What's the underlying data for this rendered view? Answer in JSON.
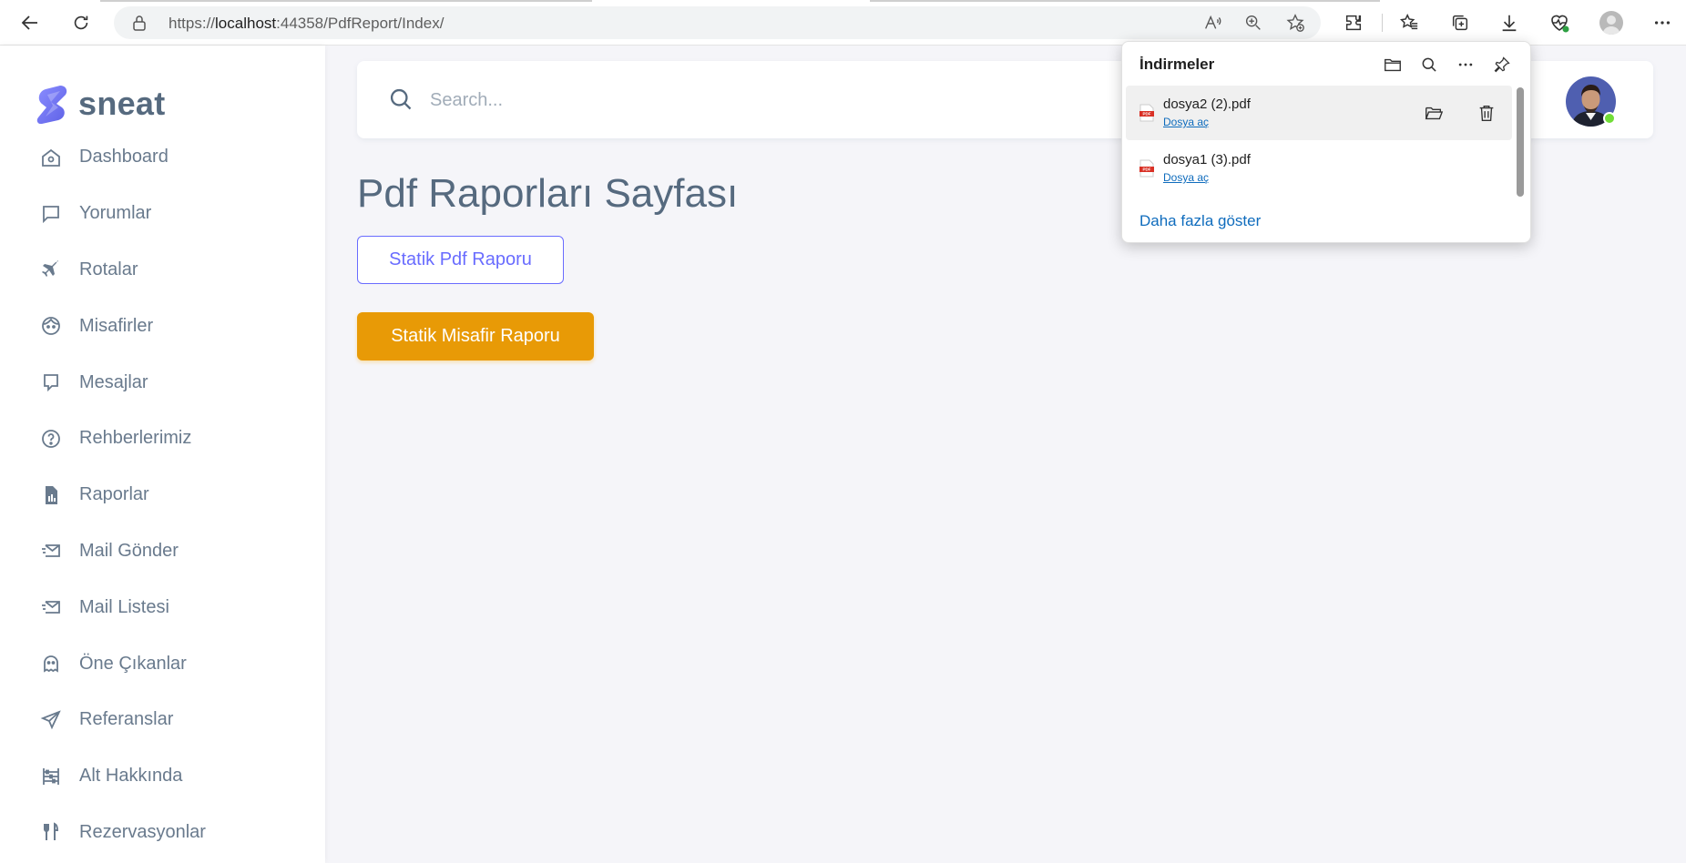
{
  "browser": {
    "url_prefix": "https://",
    "url_host": "localhost",
    "url_rest": ":44358/PdfReport/Index/"
  },
  "sidebar": {
    "brand": "sneat",
    "items": [
      {
        "label": "Dashboard",
        "icon": "home-icon"
      },
      {
        "label": "Yorumlar",
        "icon": "comment-icon"
      },
      {
        "label": "Rotalar",
        "icon": "plane-icon"
      },
      {
        "label": "Misafirler",
        "icon": "face-icon"
      },
      {
        "label": "Mesajlar",
        "icon": "message-icon"
      },
      {
        "label": "Rehberlerimiz",
        "icon": "help-circle-icon"
      },
      {
        "label": "Raporlar",
        "icon": "report-file-icon"
      },
      {
        "label": "Mail Gönder",
        "icon": "mail-send-icon"
      },
      {
        "label": "Mail Listesi",
        "icon": "mail-list-icon"
      },
      {
        "label": "Öne Çıkanlar",
        "icon": "ghost-icon"
      },
      {
        "label": "Referanslar",
        "icon": "send-icon"
      },
      {
        "label": "Alt Hakkında",
        "icon": "abacus-icon"
      },
      {
        "label": "Rezervasyonlar",
        "icon": "restaurant-icon"
      }
    ]
  },
  "search": {
    "placeholder": "Search..."
  },
  "main": {
    "title": "Pdf Raporları Sayfası",
    "btn_static_pdf": "Statik Pdf Raporu",
    "btn_static_guest": "Statik Misafir Raporu"
  },
  "downloads": {
    "title": "İndirmeler",
    "items": [
      {
        "filename": "dosya2 (2).pdf",
        "action": "Dosya aç"
      },
      {
        "filename": "dosya1 (3).pdf",
        "action": "Dosya aç"
      }
    ],
    "more": "Daha fazla göster"
  },
  "colors": {
    "primary": "#696cff",
    "warning": "#e89a06",
    "text": "#566a7f",
    "link": "#0f6cbd",
    "online": "#71dd37"
  }
}
